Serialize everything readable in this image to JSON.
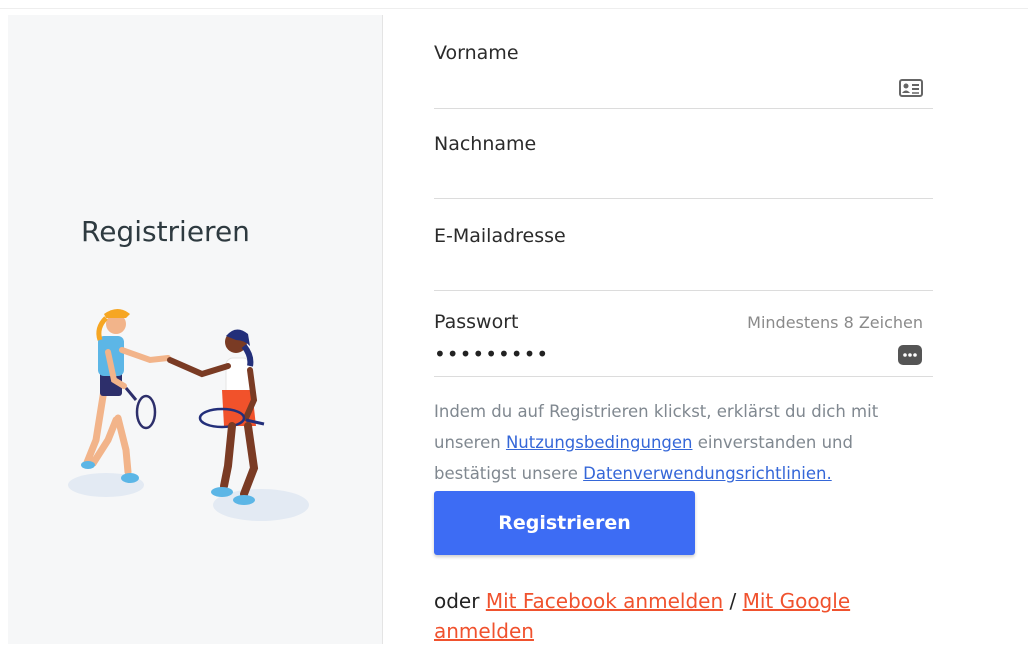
{
  "left": {
    "title": "Registrieren",
    "illustration": "two-tennis-players-handshake"
  },
  "form": {
    "first_name": {
      "label": "Vorname",
      "value": "",
      "icon": "contact-card-icon"
    },
    "last_name": {
      "label": "Nachname",
      "value": ""
    },
    "email": {
      "label": "E-Mailadresse",
      "value": ""
    },
    "password": {
      "label": "Passwort",
      "hint": "Mindestens 8 Zeichen",
      "value": "•••••••••",
      "icon": "password-manager-icon"
    }
  },
  "terms": {
    "part1": "Indem du auf Registrieren klickst, erklärst du dich mit unseren ",
    "link1": "Nutzungsbedingungen",
    "part2": " einverstanden und bestätigst unsere ",
    "link2": "Datenverwendungsrichtlinien."
  },
  "submit_label": "Registrieren",
  "social": {
    "prefix": "oder ",
    "facebook": "Mit Facebook anmelden",
    "separator": " / ",
    "google": "Mit Google anmelden"
  },
  "colors": {
    "primary": "#3d6cf4",
    "link": "#3567d8",
    "social_link": "#f0522e",
    "panel_bg": "#f6f7f8"
  }
}
